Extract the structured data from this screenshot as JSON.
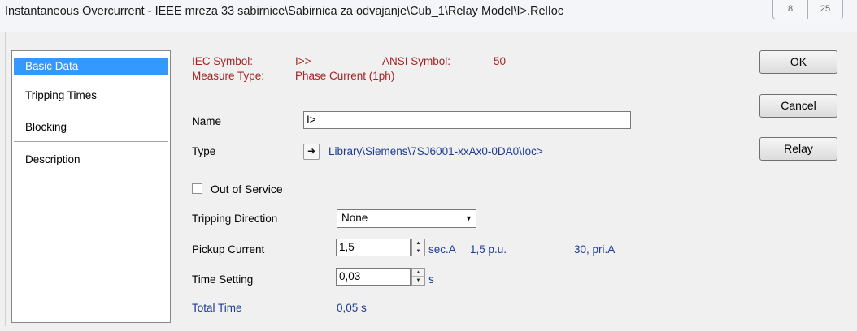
{
  "window": {
    "title": "Instantaneous Overcurrent - IEEE mreza 33 sabirnice\\Sabirnica za odvajanje\\Cub_1\\Relay Model\\I>.RelIoc",
    "help_glyph": "8",
    "close_glyph": "25"
  },
  "nav": {
    "items": [
      {
        "label": "Basic Data"
      },
      {
        "label": "Tripping Times"
      },
      {
        "label": "Blocking"
      },
      {
        "label": "Description"
      }
    ]
  },
  "info": {
    "iec_symbol_label": "IEC Symbol:",
    "iec_symbol_value": "I>>",
    "ansi_symbol_label": "ANSI Symbol:",
    "ansi_symbol_value": "50",
    "measure_type_label": "Measure Type:",
    "measure_type_value": "Phase Current (1ph)"
  },
  "form": {
    "name_label": "Name",
    "name_value": "I>",
    "type_label": "Type",
    "type_arrow": "➜",
    "type_value": "Library\\Siemens\\7SJ6001-xxAx0-0DA0\\Ioc>",
    "out_of_service_label": "Out of Service",
    "tripping_direction_label": "Tripping Direction",
    "tripping_direction_value": "None",
    "pickup_current_label": "Pickup Current",
    "pickup_current_value": "1,5",
    "pickup_unit": "sec.A",
    "pickup_pu": "1,5 p.u.",
    "pickup_pri": "30, pri.A",
    "time_setting_label": "Time Setting",
    "time_setting_value": "0,03",
    "time_setting_unit": "s",
    "total_time_label": "Total Time",
    "total_time_value": "0,05 s"
  },
  "buttons": {
    "ok": "OK",
    "cancel": "Cancel",
    "relay": "Relay"
  }
}
